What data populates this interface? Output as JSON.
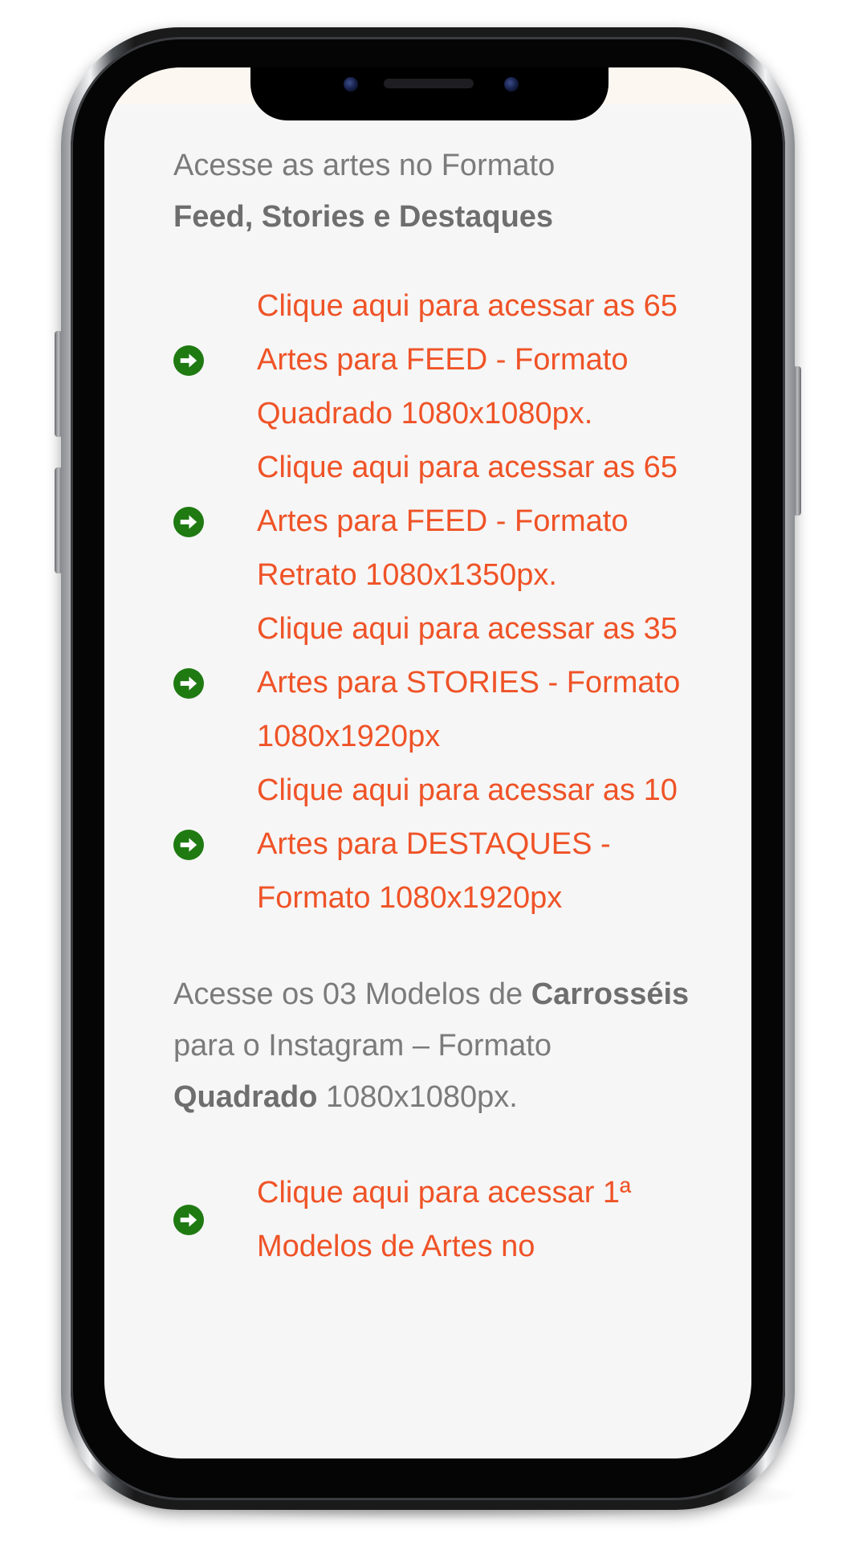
{
  "header": {
    "line1": "Acesse as artes no Formato",
    "line2_bold": "Feed, Stories e Destaques"
  },
  "feed_links": [
    {
      "text": "Clique aqui para acessar as 65 Artes para FEED - Formato Quadrado 1080x1080px.",
      "icon": "arrow-circle-right-icon"
    },
    {
      "text": "Clique aqui para acessar as 65 Artes para FEED - Formato Retrato 1080x1350px.",
      "icon": "arrow-circle-right-icon"
    },
    {
      "text": "Clique aqui para acessar as 35 Artes para STORIES - Formato 1080x1920px",
      "icon": "arrow-circle-right-icon"
    },
    {
      "text": "Clique aqui para acessar as 10 Artes para DESTAQUES - Formato 1080x1920px",
      "icon": "arrow-circle-right-icon"
    }
  ],
  "carousel_intro": {
    "t1": "Acesse os 03 Modelos de ",
    "b1": "Carrosséis",
    "t2": " para o Instagram – Formato ",
    "b2": "Quadrado",
    "t3": " 1080x1080px."
  },
  "carousel_links": [
    {
      "text": "Clique aqui para acessar 1ª Modelos de Artes no",
      "icon": "arrow-circle-right-icon"
    }
  ],
  "colors": {
    "link": "#ef5327",
    "icon": "#1f7a12",
    "text": "#7b7b7b",
    "screen_background": "#f6f6f6"
  }
}
